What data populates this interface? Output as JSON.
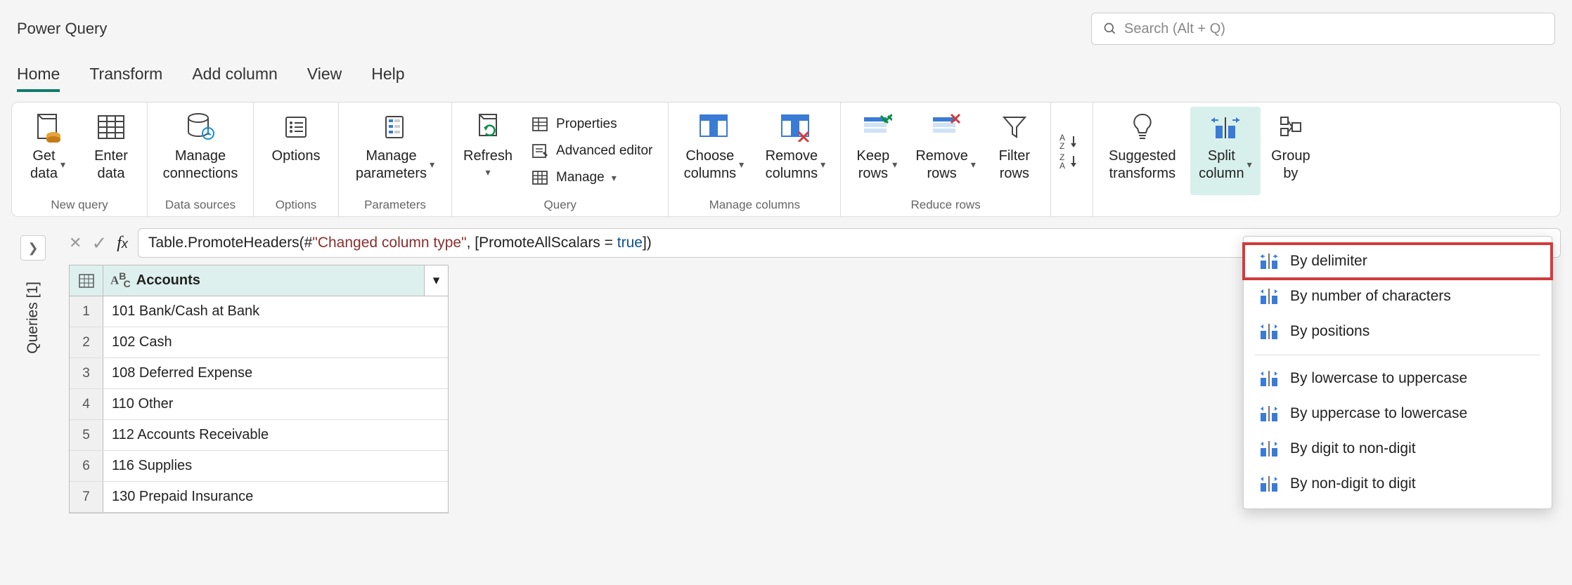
{
  "title": "Power Query",
  "search": {
    "placeholder": "Search (Alt + Q)"
  },
  "tabs": [
    "Home",
    "Transform",
    "Add column",
    "View",
    "Help"
  ],
  "activeTab": "Home",
  "ribbon": {
    "new_query_caption": "New query",
    "data_sources_caption": "Data sources",
    "options_caption": "Options",
    "parameters_caption": "Parameters",
    "query_caption": "Query",
    "manage_columns_caption": "Manage columns",
    "reduce_rows_caption": "Reduce rows",
    "get_data": "Get\ndata",
    "enter_data": "Enter\ndata",
    "manage_connections": "Manage\nconnections",
    "options": "Options",
    "manage_parameters": "Manage\nparameters",
    "refresh": "Refresh",
    "properties": "Properties",
    "advanced_editor": "Advanced editor",
    "manage": "Manage",
    "choose_columns": "Choose\ncolumns",
    "remove_columns": "Remove\ncolumns",
    "keep_rows": "Keep\nrows",
    "remove_rows": "Remove\nrows",
    "filter_rows": "Filter\nrows",
    "suggested_transforms": "Suggested\ntransforms",
    "split_column": "Split\ncolumn",
    "group_by": "Group\nby"
  },
  "formula": {
    "prefix": "Table.PromoteHeaders(#",
    "str": "\"Changed column type\"",
    "mid": ", [PromoteAllScalars = ",
    "bool": "true",
    "suffix": "])"
  },
  "queries_label": "Queries [1]",
  "column_header": "Accounts",
  "rows": [
    "101 Bank/Cash at Bank",
    "102 Cash",
    "108 Deferred Expense",
    "110 Other",
    "112 Accounts Receivable",
    "116 Supplies",
    "130 Prepaid Insurance"
  ],
  "split_menu": {
    "by_delimiter": "By delimiter",
    "by_number": "By number of characters",
    "by_positions": "By positions",
    "lower_upper": "By lowercase to uppercase",
    "upper_lower": "By uppercase to lowercase",
    "digit_nondigit": "By digit to non-digit",
    "nondigit_digit": "By non-digit to digit"
  }
}
